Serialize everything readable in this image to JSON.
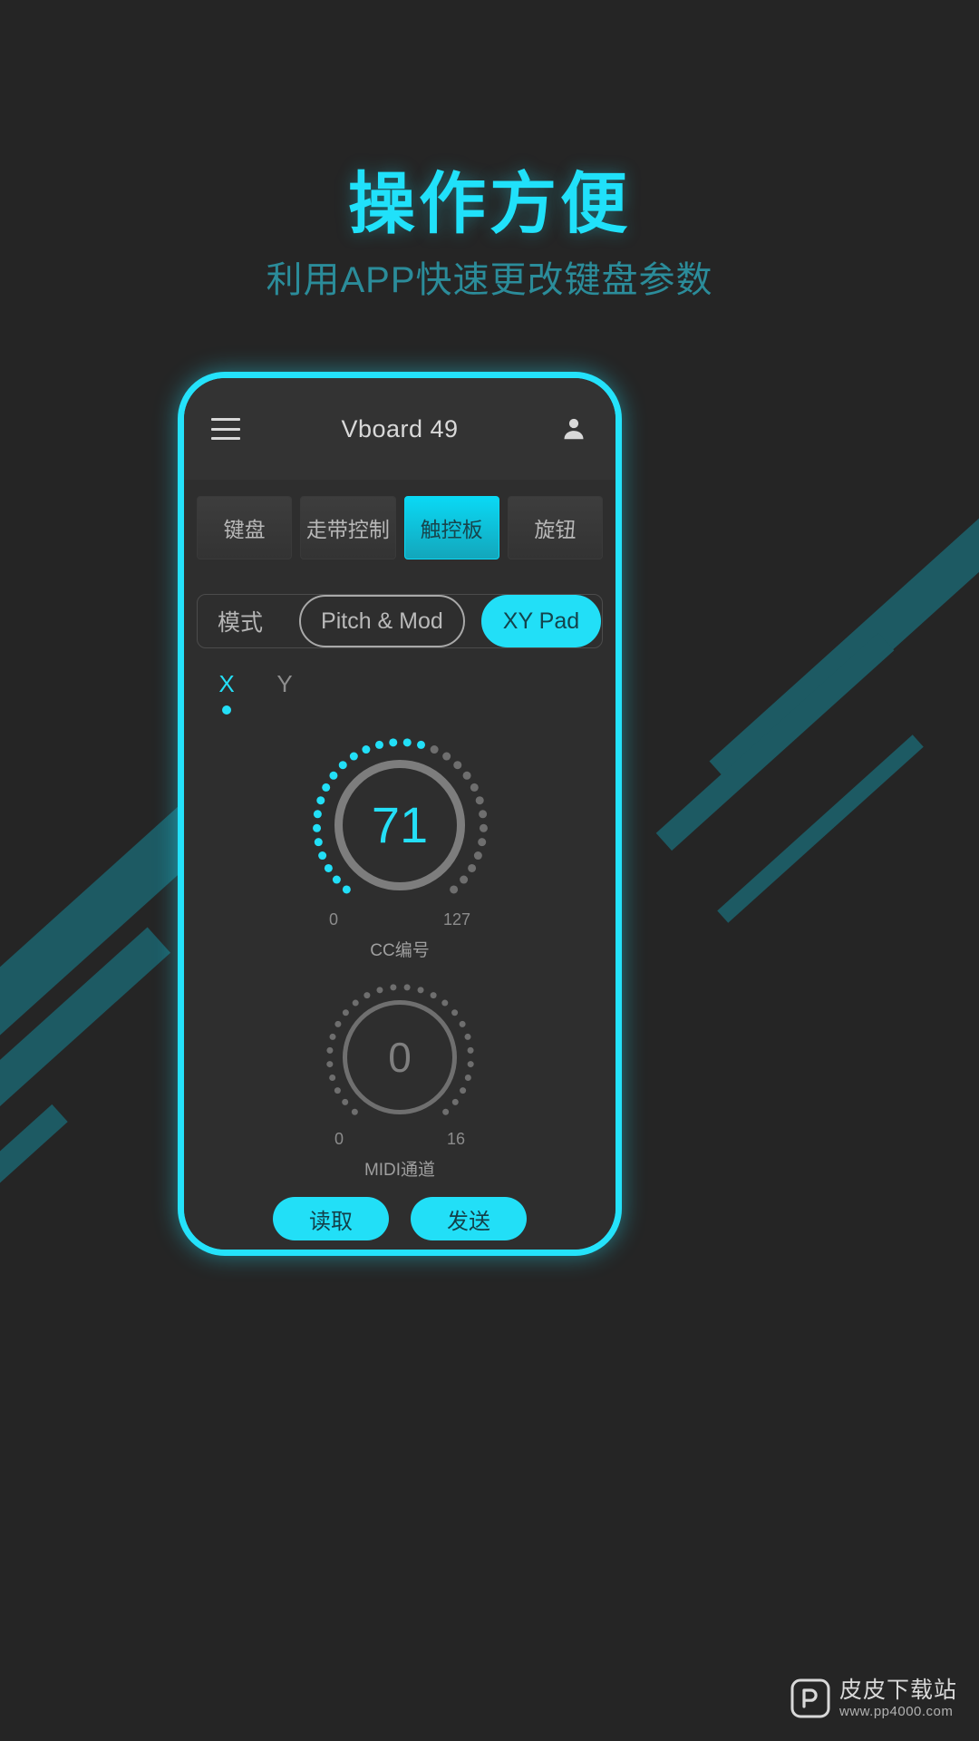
{
  "promo": {
    "title": "操作方便",
    "subtitle": "利用APP快速更改键盘参数",
    "title_color": "#20e1fa",
    "subtitle_color": "#2b8c9a",
    "background_color": "#252525",
    "stripe_color": "#1d5a63"
  },
  "phone": {
    "frame_color": "#24e2fb",
    "screen_color": "#2e2e2e"
  },
  "app": {
    "appbar": {
      "menu_icon": "hamburger-menu-icon",
      "title": "Vboard 49",
      "account_icon": "person-icon"
    },
    "tabs": [
      {
        "label": "键盘",
        "active": false
      },
      {
        "label": "走带控制",
        "active": false
      },
      {
        "label": "触控板",
        "active": true
      },
      {
        "label": "旋钮",
        "active": false
      }
    ],
    "mode": {
      "label": "模式",
      "options": [
        {
          "label": "Pitch & Mod",
          "active": false
        },
        {
          "label": "XY Pad",
          "active": true
        }
      ]
    },
    "axis_tabs": [
      {
        "label": "X",
        "active": true
      },
      {
        "label": "Y",
        "active": false
      }
    ],
    "knobs": [
      {
        "value": "71",
        "value_number": 71,
        "min_label": "0",
        "max_label": "127",
        "min": 0,
        "max": 127,
        "caption": "CC编号",
        "active": true,
        "tick_count": 30,
        "accent_color": "#22dff7"
      },
      {
        "value": "0",
        "value_number": 0,
        "min_label": "0",
        "max_label": "16",
        "min": 0,
        "max": 16,
        "caption": "MIDI通道",
        "active": false,
        "tick_count": 26,
        "accent_color": "#6e6e6e"
      }
    ],
    "actions": [
      {
        "label": "读取"
      },
      {
        "label": "发送"
      }
    ]
  },
  "watermark": {
    "name": "皮皮下载站",
    "url": "www.pp4000.com",
    "logo_text": "P"
  }
}
